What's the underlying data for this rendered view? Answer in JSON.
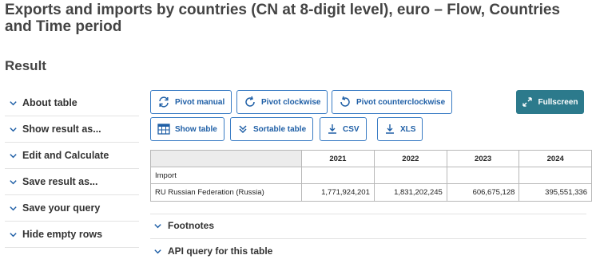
{
  "page": {
    "title": "Exports and imports by countries (CN at 8-digit level), euro – Flow, Countries and Time period",
    "result_heading": "Result"
  },
  "sidebar": {
    "items": [
      {
        "label": "About table"
      },
      {
        "label": "Show result as..."
      },
      {
        "label": "Edit and Calculate"
      },
      {
        "label": "Save result as..."
      },
      {
        "label": "Save your query"
      },
      {
        "label": "Hide empty rows"
      }
    ]
  },
  "toolbar": {
    "pivot_manual": "Pivot manual",
    "pivot_clockwise": "Pivot clockwise",
    "pivot_counterclockwise": "Pivot counterclockwise",
    "fullscreen": "Fullscreen",
    "show_table": "Show table",
    "sortable_table": "Sortable table",
    "csv": "CSV",
    "xls": "XLS"
  },
  "table": {
    "corner": "",
    "columns": [
      "2021",
      "2022",
      "2023",
      "2024"
    ],
    "group_label": "Import",
    "rows": [
      {
        "label": "RU Russian Federation (Russia)",
        "values": [
          "1,771,924,201",
          "1,831,202,245",
          "606,675,128",
          "395,551,336"
        ]
      }
    ]
  },
  "accordions": {
    "footnotes": "Footnotes",
    "api_query": "API query for this table"
  },
  "colors": {
    "accent": "#1f5fa6",
    "fullscreen_bg": "#2c7a8c"
  }
}
